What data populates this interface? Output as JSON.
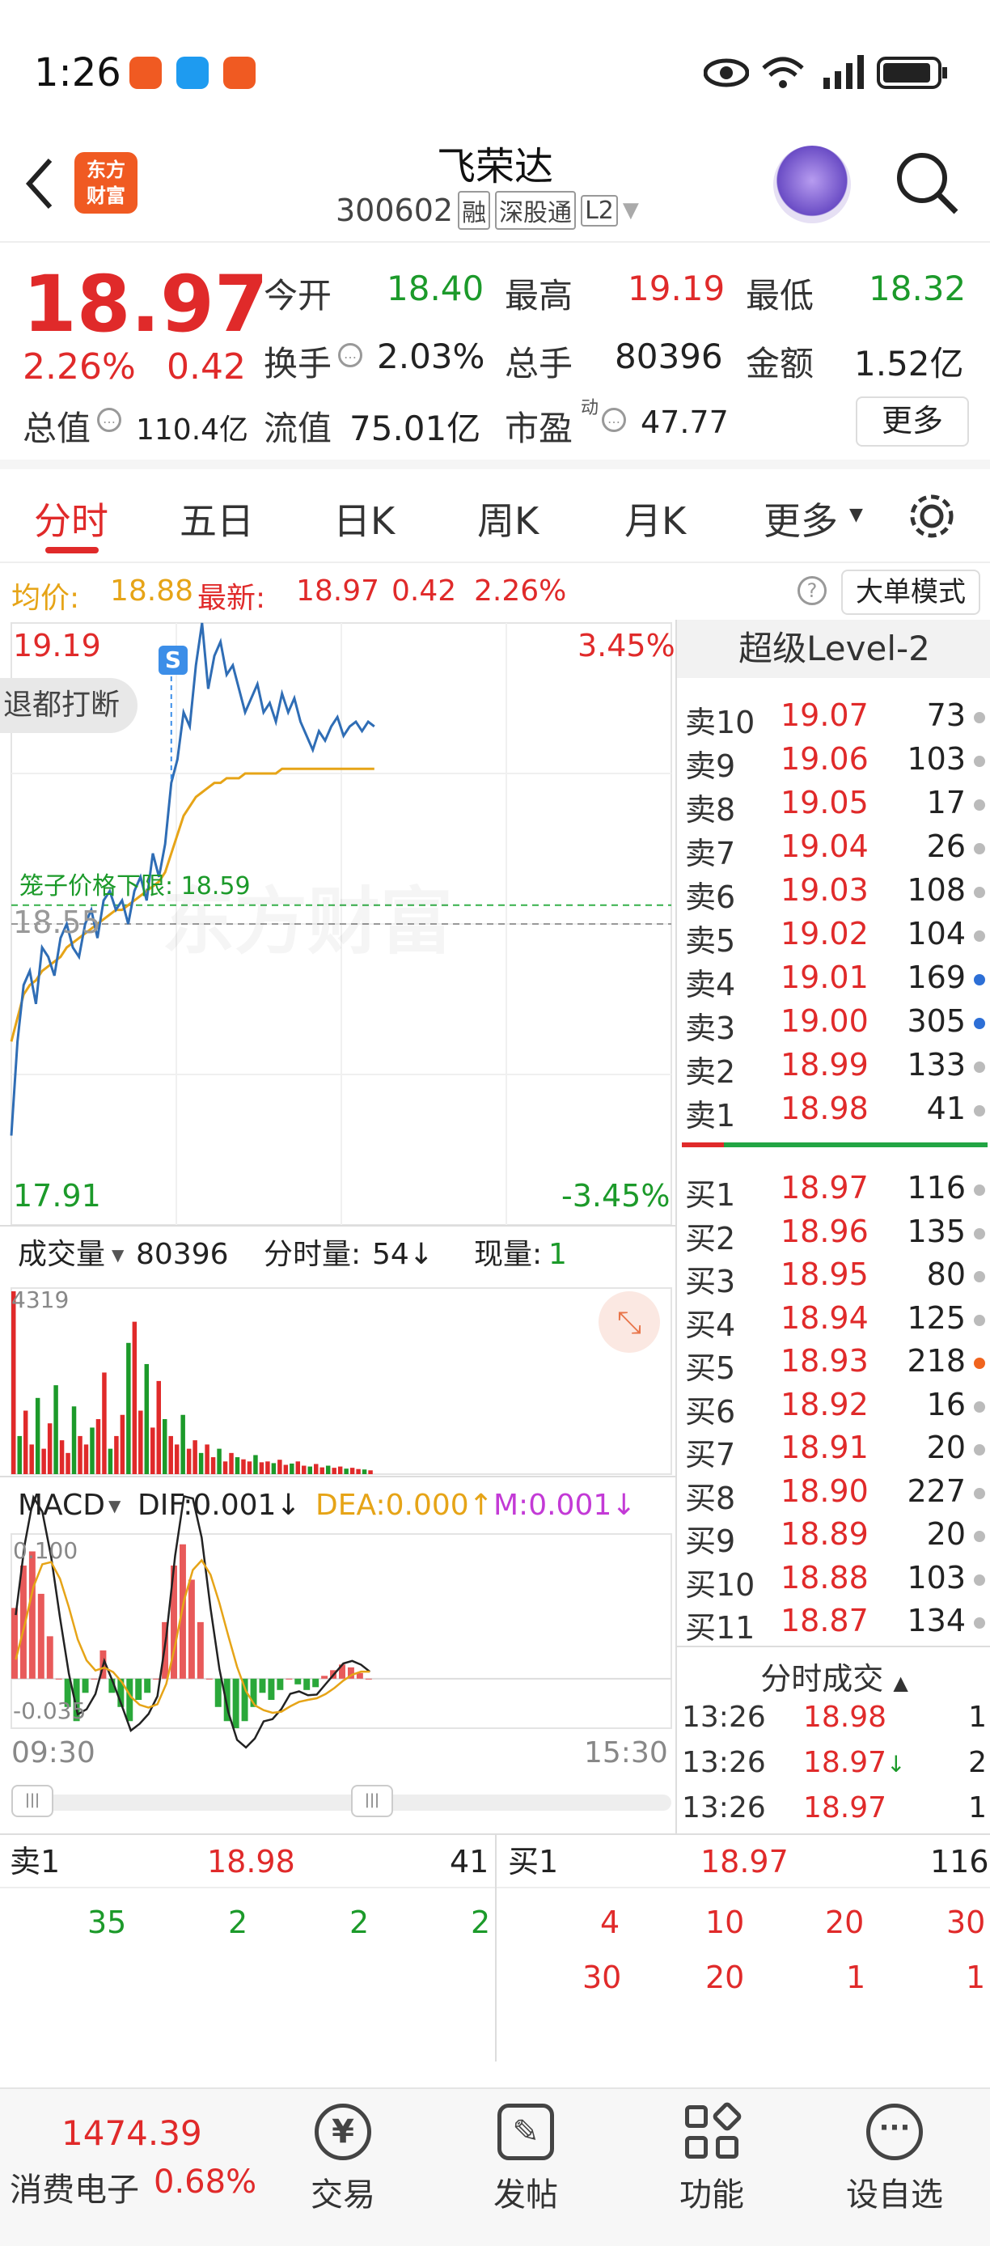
{
  "status": {
    "time": "1:26"
  },
  "header": {
    "stock_name": "飞荣达",
    "code": "300602",
    "tags": [
      "融",
      "深股通",
      "L2"
    ],
    "logo_text": "东方\n财富"
  },
  "quote": {
    "price": "18.97",
    "change_pct": "2.26%",
    "change": "0.42",
    "open_label": "今开",
    "open": "18.40",
    "high_label": "最高",
    "high": "19.19",
    "low_label": "最低",
    "low": "18.32",
    "turnover_label": "换手",
    "turnover": "2.03%",
    "volume_label": "总手",
    "volume": "80396",
    "amount_label": "金额",
    "amount": "1.52亿",
    "mktcap_label": "总值",
    "mktcap": "110.4亿",
    "float_label": "流值",
    "float": "75.01亿",
    "pe_label": "市盈",
    "pe_sup": "动",
    "pe": "47.77",
    "more_button": "更多"
  },
  "tabs": [
    "分时",
    "五日",
    "日K",
    "周K",
    "月K",
    "更多"
  ],
  "infobar": {
    "avg_label": "均价:",
    "avg": "18.88",
    "latest_label": "最新:",
    "latest": "18.97",
    "chg": "0.42",
    "pct": "2.26%",
    "mode_button": "大单模式"
  },
  "chart": {
    "y_high": "19.19",
    "y_low": "17.91",
    "pct_high": "3.45%",
    "pct_low": "-3.45%",
    "mid": "18.55",
    "cage_label": "笼子价格下限:",
    "cage_value": "18.59",
    "toast": "退都打断",
    "watermark": "东方财富",
    "s_marker": "S",
    "vol_label": "成交量",
    "vol_total": "80396",
    "vol_min_label": "分时量:",
    "vol_min": "54↓",
    "vol_now_label": "现量:",
    "vol_now": "1",
    "vol_max": "4319",
    "macd_label": "MACD",
    "dif": "DIF:0.001↓",
    "dea": "DEA:0.000↑",
    "m": "M:0.001↓",
    "macd_top": "0.100",
    "macd_bottom": "-0.035",
    "t_start": "09:30",
    "t_end": "15:30",
    "price": [
      18.1,
      18.3,
      18.42,
      18.45,
      18.38,
      18.5,
      18.48,
      18.44,
      18.52,
      18.55,
      18.5,
      18.48,
      18.55,
      18.58,
      18.52,
      18.6,
      18.62,
      18.58,
      18.6,
      18.55,
      18.62,
      18.65,
      18.6,
      18.7,
      18.65,
      18.72,
      18.85,
      18.9,
      19.0,
      18.97,
      19.1,
      19.19,
      19.05,
      19.12,
      19.15,
      19.08,
      19.1,
      19.05,
      19.0,
      19.03,
      19.06,
      19.0,
      19.02,
      18.98,
      19.04,
      19.0,
      19.03,
      18.98,
      18.95,
      18.92,
      18.96,
      18.94,
      18.97,
      18.99,
      18.95,
      18.97,
      18.98,
      18.96,
      18.98,
      18.97
    ],
    "avg": [
      18.3,
      18.35,
      18.4,
      18.42,
      18.43,
      18.45,
      18.46,
      18.47,
      18.48,
      18.5,
      18.51,
      18.52,
      18.53,
      18.54,
      18.55,
      18.56,
      18.57,
      18.58,
      18.58,
      18.59,
      18.6,
      18.61,
      18.62,
      18.63,
      18.64,
      18.66,
      18.7,
      18.74,
      18.78,
      18.8,
      18.82,
      18.83,
      18.84,
      18.85,
      18.85,
      18.86,
      18.86,
      18.86,
      18.87,
      18.87,
      18.87,
      18.87,
      18.87,
      18.87,
      18.88,
      18.88,
      18.88,
      18.88,
      18.88,
      18.88,
      18.88,
      18.88,
      18.88,
      18.88,
      18.88,
      18.88,
      18.88,
      18.88,
      18.88,
      18.88
    ],
    "vol": [
      4319,
      900,
      1500,
      700,
      1800,
      600,
      1200,
      2100,
      800,
      500,
      1600,
      900,
      700,
      1100,
      1300,
      2400,
      600,
      900,
      1400,
      3100,
      3600,
      1500,
      2600,
      1100,
      2200,
      1300,
      900,
      700,
      1400,
      600,
      800,
      500,
      700,
      400,
      600,
      300,
      500,
      400,
      350,
      300,
      450,
      280,
      300,
      260,
      340,
      220,
      250,
      300,
      200,
      180,
      240,
      160,
      200,
      150,
      180,
      130,
      150,
      120,
      110,
      90
    ],
    "macd": [
      0.05,
      0.08,
      0.09,
      0.06,
      0.03,
      0.0,
      -0.02,
      -0.03,
      -0.01,
      0.0,
      0.02,
      -0.01,
      -0.02,
      -0.03,
      -0.015,
      -0.01,
      0.0,
      0.04,
      0.08,
      0.095,
      0.07,
      0.04,
      0.0,
      -0.02,
      -0.03,
      -0.035,
      -0.03,
      -0.02,
      -0.01,
      -0.015,
      -0.008,
      0.0,
      -0.004,
      -0.008,
      -0.006,
      0.002,
      0.006,
      0.01,
      0.008,
      0.004,
      0.0
    ]
  },
  "level2": {
    "title": "超级Level-2",
    "sells": [
      {
        "l": "卖10",
        "p": "19.07",
        "v": "73"
      },
      {
        "l": "卖9",
        "p": "19.06",
        "v": "103"
      },
      {
        "l": "卖8",
        "p": "19.05",
        "v": "17"
      },
      {
        "l": "卖7",
        "p": "19.04",
        "v": "26"
      },
      {
        "l": "卖6",
        "p": "19.03",
        "v": "108"
      },
      {
        "l": "卖5",
        "p": "19.02",
        "v": "104"
      },
      {
        "l": "卖4",
        "p": "19.01",
        "v": "169"
      },
      {
        "l": "卖3",
        "p": "19.00",
        "v": "305"
      },
      {
        "l": "卖2",
        "p": "18.99",
        "v": "133"
      },
      {
        "l": "卖1",
        "p": "18.98",
        "v": "41"
      }
    ],
    "buys": [
      {
        "l": "买1",
        "p": "18.97",
        "v": "116"
      },
      {
        "l": "买2",
        "p": "18.96",
        "v": "135"
      },
      {
        "l": "买3",
        "p": "18.95",
        "v": "80"
      },
      {
        "l": "买4",
        "p": "18.94",
        "v": "125"
      },
      {
        "l": "买5",
        "p": "18.93",
        "v": "218"
      },
      {
        "l": "买6",
        "p": "18.92",
        "v": "16"
      },
      {
        "l": "买7",
        "p": "18.91",
        "v": "20"
      },
      {
        "l": "买8",
        "p": "18.90",
        "v": "227"
      },
      {
        "l": "买9",
        "p": "18.89",
        "v": "20"
      },
      {
        "l": "买10",
        "p": "18.88",
        "v": "103"
      },
      {
        "l": "买11",
        "p": "18.87",
        "v": "134"
      }
    ],
    "trades_title": "分时成交",
    "trades": [
      {
        "t": "13:26",
        "p": "18.98",
        "v": "1",
        "arrow": ""
      },
      {
        "t": "13:26",
        "p": "18.97",
        "v": "2",
        "arrow": "↓"
      },
      {
        "t": "13:26",
        "p": "18.97",
        "v": "1",
        "arrow": ""
      }
    ]
  },
  "queue": {
    "sell_label": "卖1",
    "sell_price": "18.98",
    "sell_vol": "41",
    "buy_label": "买1",
    "buy_price": "18.97",
    "buy_vol": "116",
    "sell_orders": [
      "35",
      "2",
      "2",
      "2"
    ],
    "buy_orders_1": [
      "4",
      "10",
      "20",
      "30"
    ],
    "buy_orders_2": [
      "30",
      "20",
      "1",
      "1"
    ]
  },
  "footer": {
    "index_value": "1474.39",
    "index_name": "消费电子",
    "index_pct": "0.68%",
    "btn_trade": "交易",
    "btn_post": "发帖",
    "btn_func": "功能",
    "btn_watch": "设自选"
  }
}
